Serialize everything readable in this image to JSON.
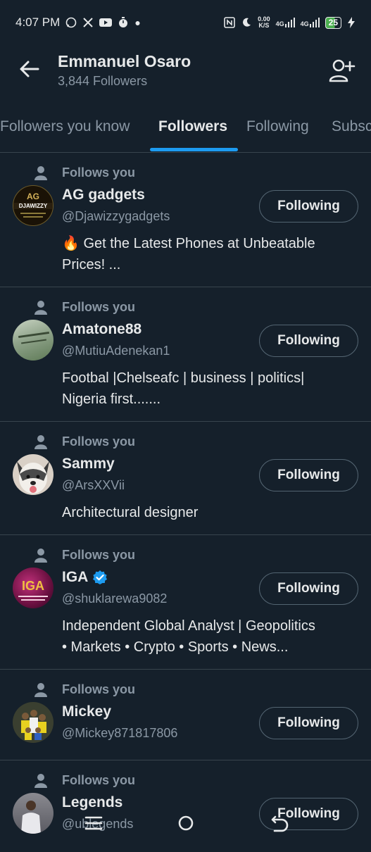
{
  "status_bar": {
    "time": "4:07 PM",
    "left_icons": [
      "whatsapp-icon",
      "x-icon",
      "youtube-icon",
      "timer-icon",
      "dot-icon"
    ],
    "right_icons": [
      "nfc-icon",
      "moon-icon",
      "data-speed",
      "signal-4g-icon",
      "signal-4g-icon",
      "battery-icon",
      "charging-icon"
    ],
    "data_speed": "0.00",
    "data_unit": "K/S",
    "network_1": "4G",
    "network_2": "4G",
    "battery": "25"
  },
  "header": {
    "title": "Emmanuel Osaro",
    "subtitle": "3,844 Followers"
  },
  "tabs": [
    {
      "label": "Followers you know"
    },
    {
      "label": "Followers"
    },
    {
      "label": "Following"
    },
    {
      "label": "Subsc"
    }
  ],
  "active_tab": "Followers",
  "colors": {
    "accent": "#1d9bf0",
    "background": "#15202b",
    "muted": "#8b98a5",
    "border": "#38444d"
  },
  "followers": [
    {
      "follows_you": "Follows you",
      "name": "AG gadgets",
      "handle": "@Djawizzygadgets",
      "bio_line1": "🔥 Get the Latest Phones at Unbeatable",
      "bio_line2": "Prices!  ...",
      "button": "Following",
      "verified": false
    },
    {
      "follows_you": "Follows you",
      "name": "Amatone88",
      "handle": "@MutiuAdenekan1",
      "bio_line1": "Footbal |Chelseafc | business | politics|",
      "bio_line2": "Nigeria first.......",
      "button": "Following",
      "verified": false
    },
    {
      "follows_you": "Follows you",
      "name": "Sammy",
      "handle": "@ArsXXVii",
      "bio_line1": "Architectural designer",
      "bio_line2": "",
      "button": "Following",
      "verified": false
    },
    {
      "follows_you": "Follows you",
      "name": "IGA",
      "handle": "@shuklarewa9082",
      "bio_line1": "Independent Global Analyst | Geopolitics",
      "bio_line2": "• Markets • Crypto • Sports • News...",
      "button": "Following",
      "verified": true
    },
    {
      "follows_you": "Follows you",
      "name": "Mickey",
      "handle": "@Mickey871817806",
      "bio_line1": "",
      "bio_line2": "",
      "button": "Following",
      "verified": false
    },
    {
      "follows_you": "Follows you",
      "name": "Legends",
      "handle": "@ublegends",
      "bio_line1": "",
      "bio_line2": "",
      "button": "Following",
      "verified": false
    }
  ],
  "avatar_text": {
    "ag_top": "AG",
    "ag_brand": "DJAWIZZY",
    "iga_logo": "IGA"
  },
  "nav_icons": [
    "recents-icon",
    "home-icon",
    "back-icon"
  ]
}
